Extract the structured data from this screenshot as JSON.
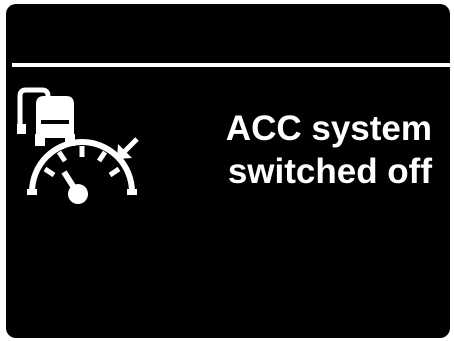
{
  "display": {
    "message_line1": "ACC system",
    "message_line2": "switched off",
    "icon": "acc-distance-speedometer-icon",
    "colors": {
      "background": "#000000",
      "foreground": "#ffffff",
      "outer_frame": "#ffffff"
    }
  }
}
